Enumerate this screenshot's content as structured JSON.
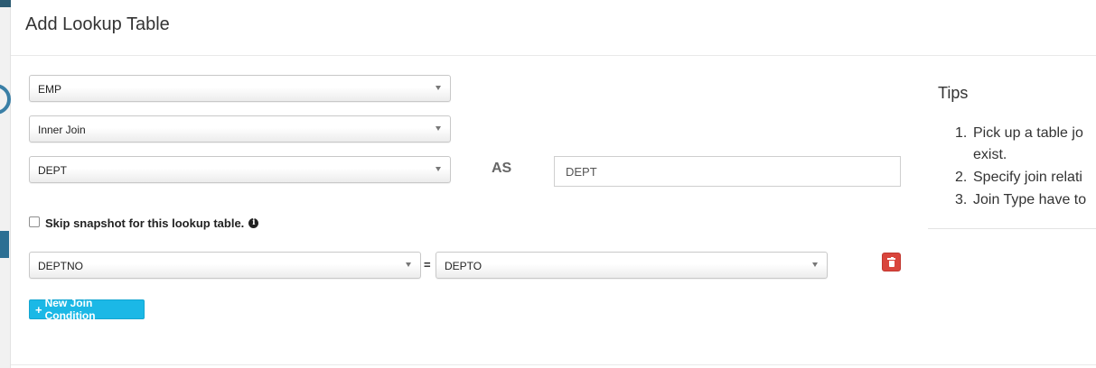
{
  "modal": {
    "title": "Add Lookup Table"
  },
  "form": {
    "fact_table": {
      "value": "EMP"
    },
    "join_type": {
      "value": "Inner Join"
    },
    "lookup_table": {
      "value": "DEPT"
    },
    "as_label": "AS",
    "alias": {
      "value": "DEPT"
    },
    "skip_snapshot": {
      "label": "Skip snapshot for this lookup table.",
      "checked": false
    },
    "join_conditions": [
      {
        "left": "DEPTNO",
        "operator": "=",
        "right": "DEPTO"
      }
    ],
    "new_join_button": "New Join Condition"
  },
  "tips": {
    "title": "Tips",
    "items": [
      {
        "num": "1.",
        "text": "Pick up a table jo",
        "cont": "exist."
      },
      {
        "num": "2.",
        "text": "Specify join relati"
      },
      {
        "num": "3.",
        "text": "Join Type have to"
      }
    ]
  },
  "icons": {
    "caret": "caret-down-icon",
    "info": "info-icon",
    "trash": "trash-icon",
    "plus": "plus-icon"
  },
  "colors": {
    "add_button": "#1bb8e6",
    "delete_button": "#d9453c"
  }
}
